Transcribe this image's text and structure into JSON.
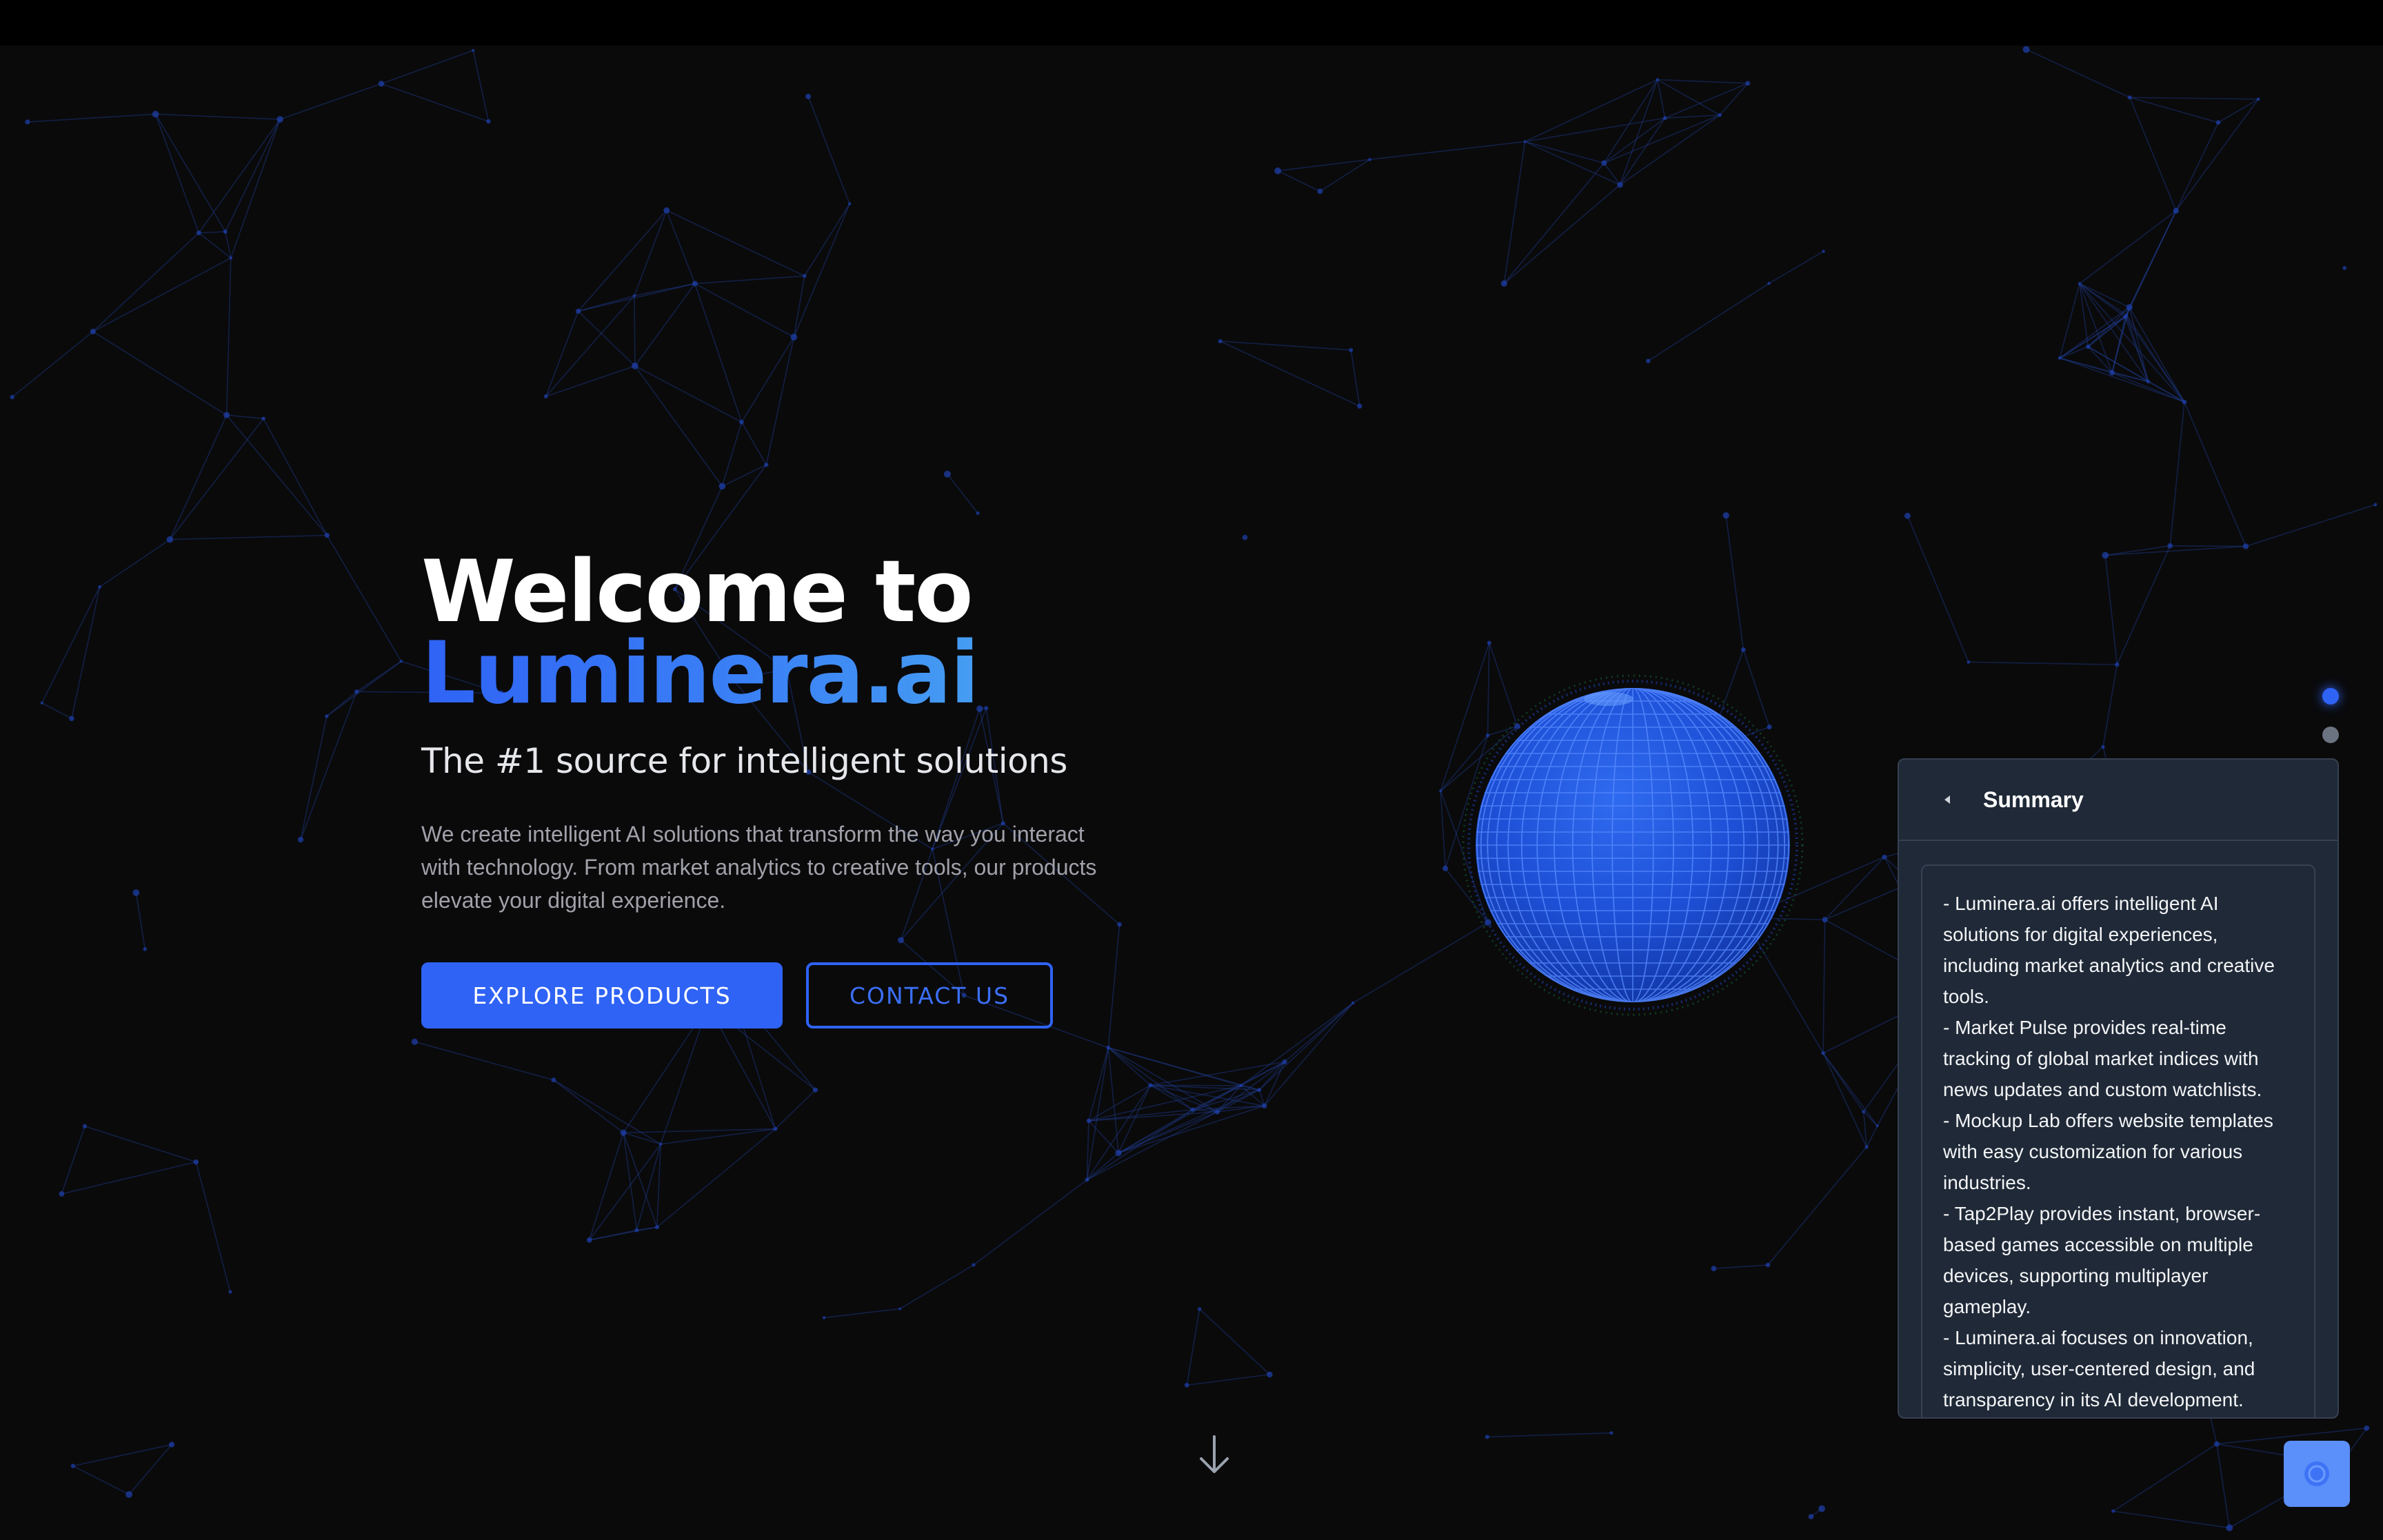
{
  "hero": {
    "title_line1": "Welcome to",
    "title_line2": "Luminera.ai",
    "subtitle": "The #1 source for intelligent solutions",
    "description": "We create intelligent AI solutions that transform the way you interact with technology. From market analytics to creative tools, our products elevate your digital experience.",
    "explore_label": "EXPLORE PRODUCTS",
    "contact_label": "CONTACT US"
  },
  "summary": {
    "title": "Summary",
    "lines": [
      "- Luminera.ai offers intelligent AI solutions for digital experiences, including market analytics and creative tools.",
      "- Market Pulse provides real-time tracking of global market indices with news updates and custom watchlists.",
      "- Mockup Lab offers website templates with easy customization for various industries.",
      "- Tap2Play provides instant, browser-based games accessible on multiple devices, supporting multiplayer gameplay.",
      "- Luminera.ai focuses on innovation, simplicity, user-centered design, and transparency in its AI development."
    ]
  },
  "icons": {
    "scroll": "arrow-down-icon",
    "collapse": "triangle-left-icon",
    "chat": "chat-bubble-icon"
  },
  "colors": {
    "background": "#0a0a0b",
    "accent": "#2f63f5",
    "accent_light": "#4fb6ee",
    "panel": "#1f2937",
    "network_line": "#1e3a8a"
  }
}
